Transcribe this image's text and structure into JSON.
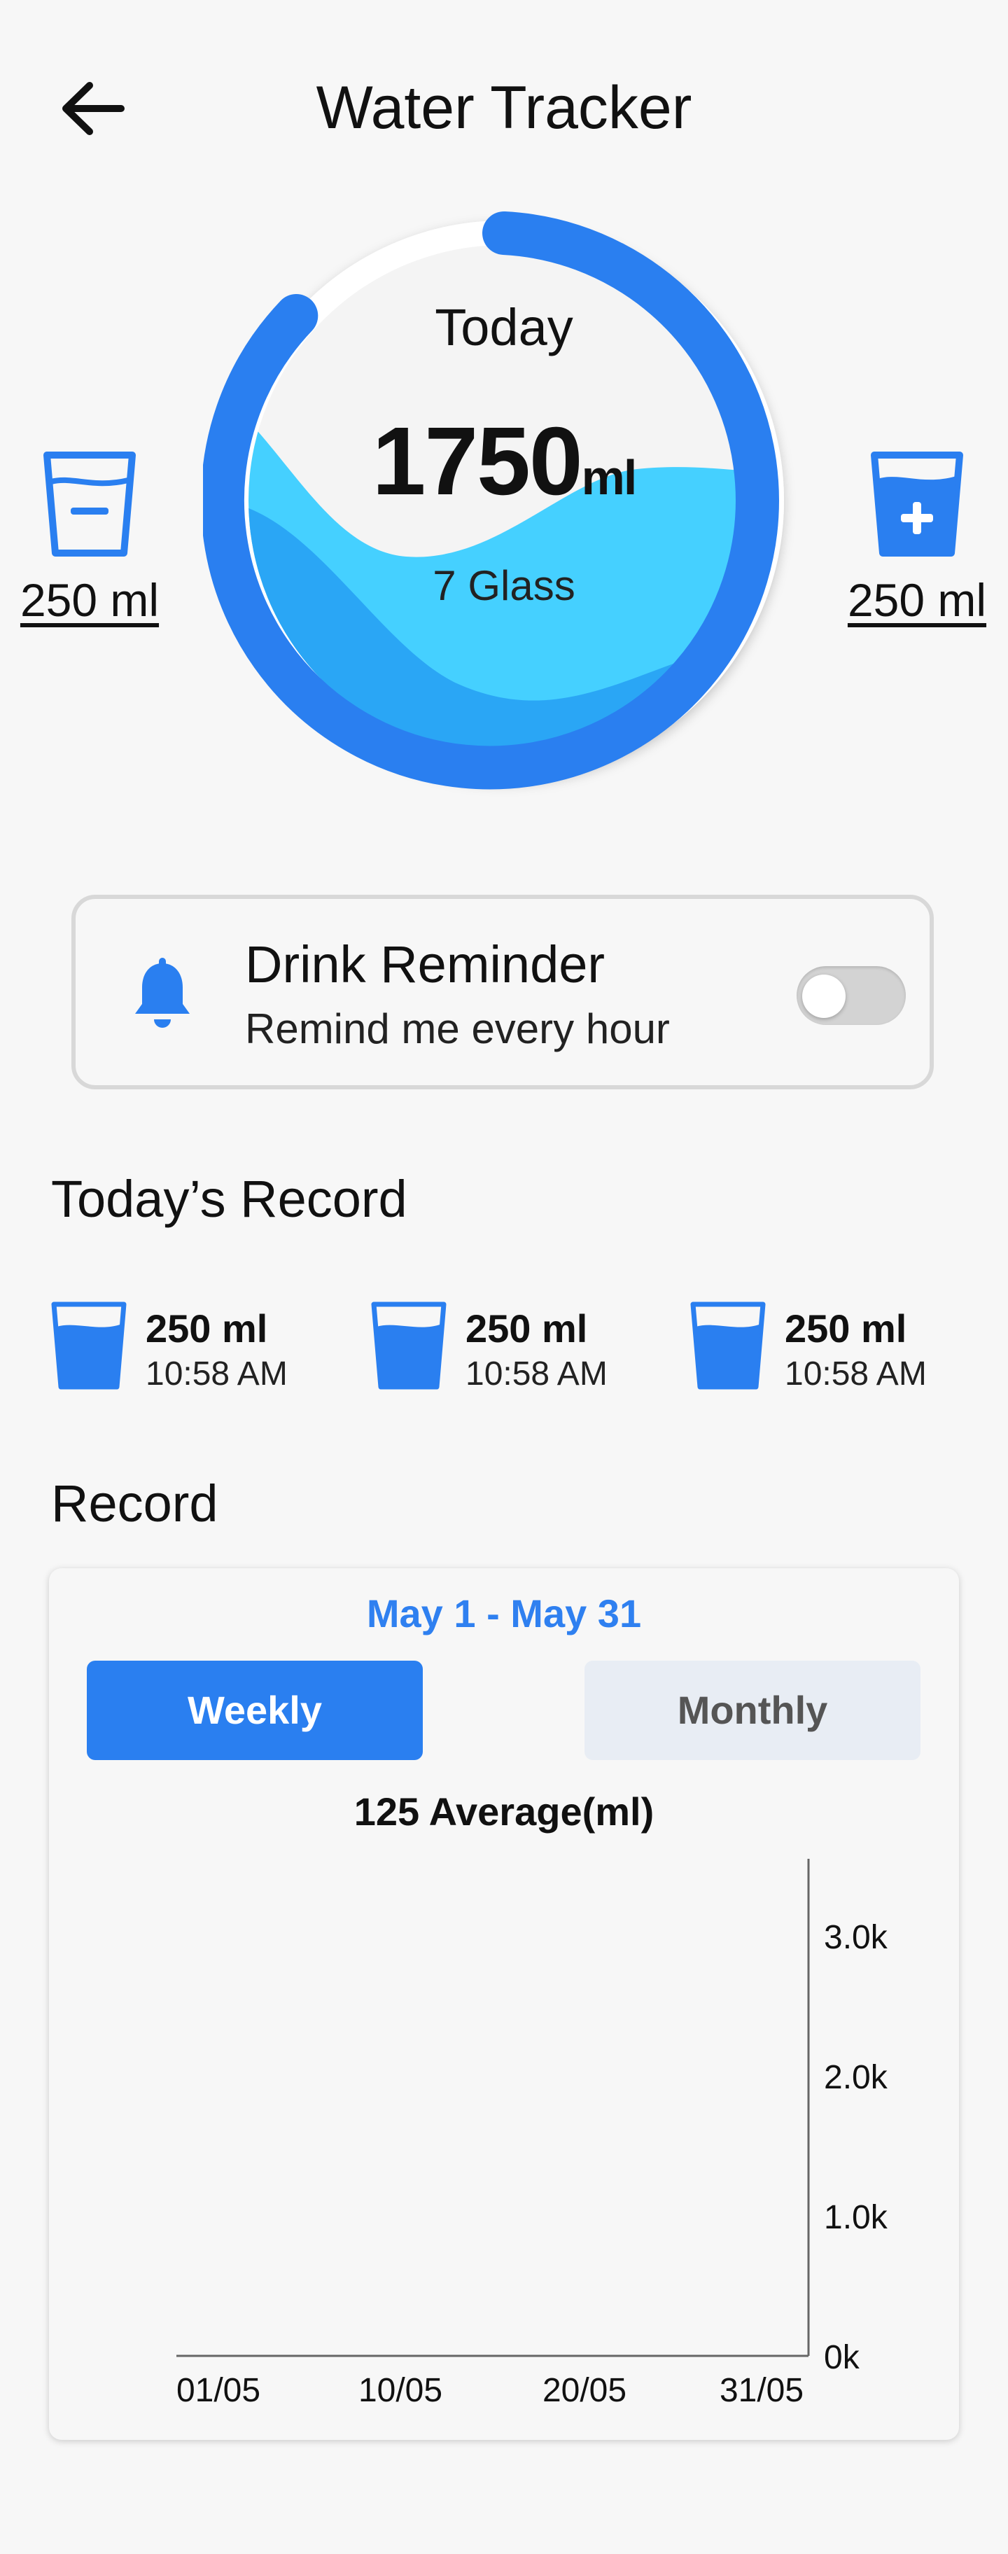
{
  "header": {
    "title": "Water Tracker"
  },
  "gauge": {
    "today_label": "Today",
    "value": "1750",
    "unit": "ml",
    "glasses": "7 Glass",
    "progress_color": "#2a7ff0",
    "water_light": "#45d0ff",
    "water_dark": "#2aa6f5"
  },
  "cups": {
    "remove_label": "250 ml",
    "add_label": "250 ml"
  },
  "reminder": {
    "title": "Drink Reminder",
    "subtitle": "Remind me every hour",
    "enabled": false
  },
  "today_record": {
    "heading": "Today’s Record",
    "items": [
      {
        "amount": "250 ml",
        "time": "10:58 AM"
      },
      {
        "amount": "250 ml",
        "time": "10:58 AM"
      },
      {
        "amount": "250 ml",
        "time": "10:58 AM"
      }
    ]
  },
  "record": {
    "heading": "Record",
    "range": "May 1 - May 31",
    "tabs": {
      "weekly": "Weekly",
      "monthly": "Monthly",
      "selected": "Weekly"
    },
    "average": "125 Average(ml)"
  },
  "chart_data": {
    "type": "bar",
    "x_ticks": [
      "01/05",
      "10/05",
      "20/05",
      "31/05"
    ],
    "y_ticks": [
      "0k",
      "1.0k",
      "2.0k",
      "3.0k"
    ],
    "ylim": [
      0,
      3000
    ],
    "series": [],
    "grid": false
  },
  "colors": {
    "accent": "#2a7ff0",
    "background": "#f7f7f7"
  }
}
